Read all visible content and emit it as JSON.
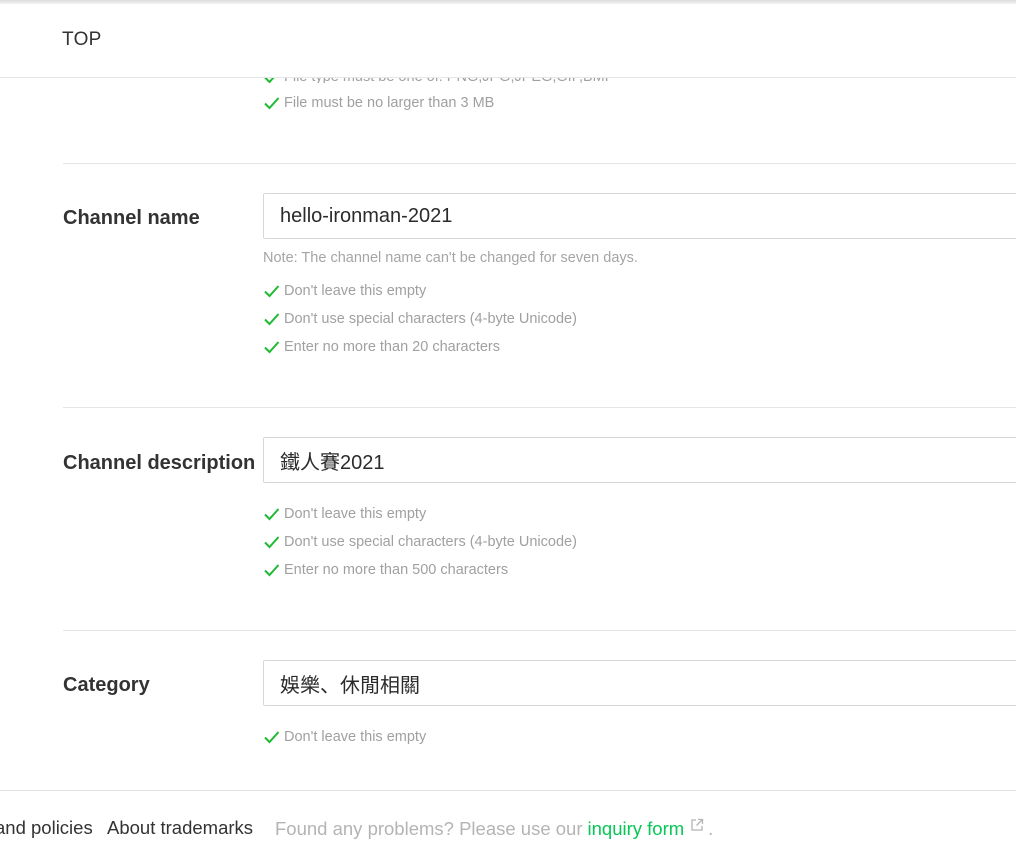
{
  "header": {
    "top_label": "TOP"
  },
  "image_section": {
    "rules": [
      "File type must be one of: PNG,JPG,JPEG,GIF,BMP",
      "File must be no larger than 3 MB"
    ]
  },
  "channel_name": {
    "label": "Channel name",
    "value": "hello-ironman-2021",
    "note": "Note: The channel name can't be changed for seven days.",
    "rules": [
      "Don't leave this empty",
      "Don't use special characters (4-byte Unicode)",
      "Enter no more than 20 characters"
    ]
  },
  "channel_description": {
    "label": "Channel description",
    "value": "鐵人賽2021",
    "rules": [
      "Don't leave this empty",
      "Don't use special characters (4-byte Unicode)",
      "Enter no more than 500 characters"
    ]
  },
  "category": {
    "label": "Category",
    "value": "娛樂、休閒相關",
    "rules": [
      "Don't leave this empty"
    ]
  },
  "footer": {
    "policies": "and policies",
    "trademarks": "About trademarks",
    "problem_text": "Found any problems? Please use our",
    "inquiry_link": "inquiry form",
    "period": "."
  },
  "colors": {
    "accent_green": "#06c755",
    "check_green": "#1fba33"
  }
}
